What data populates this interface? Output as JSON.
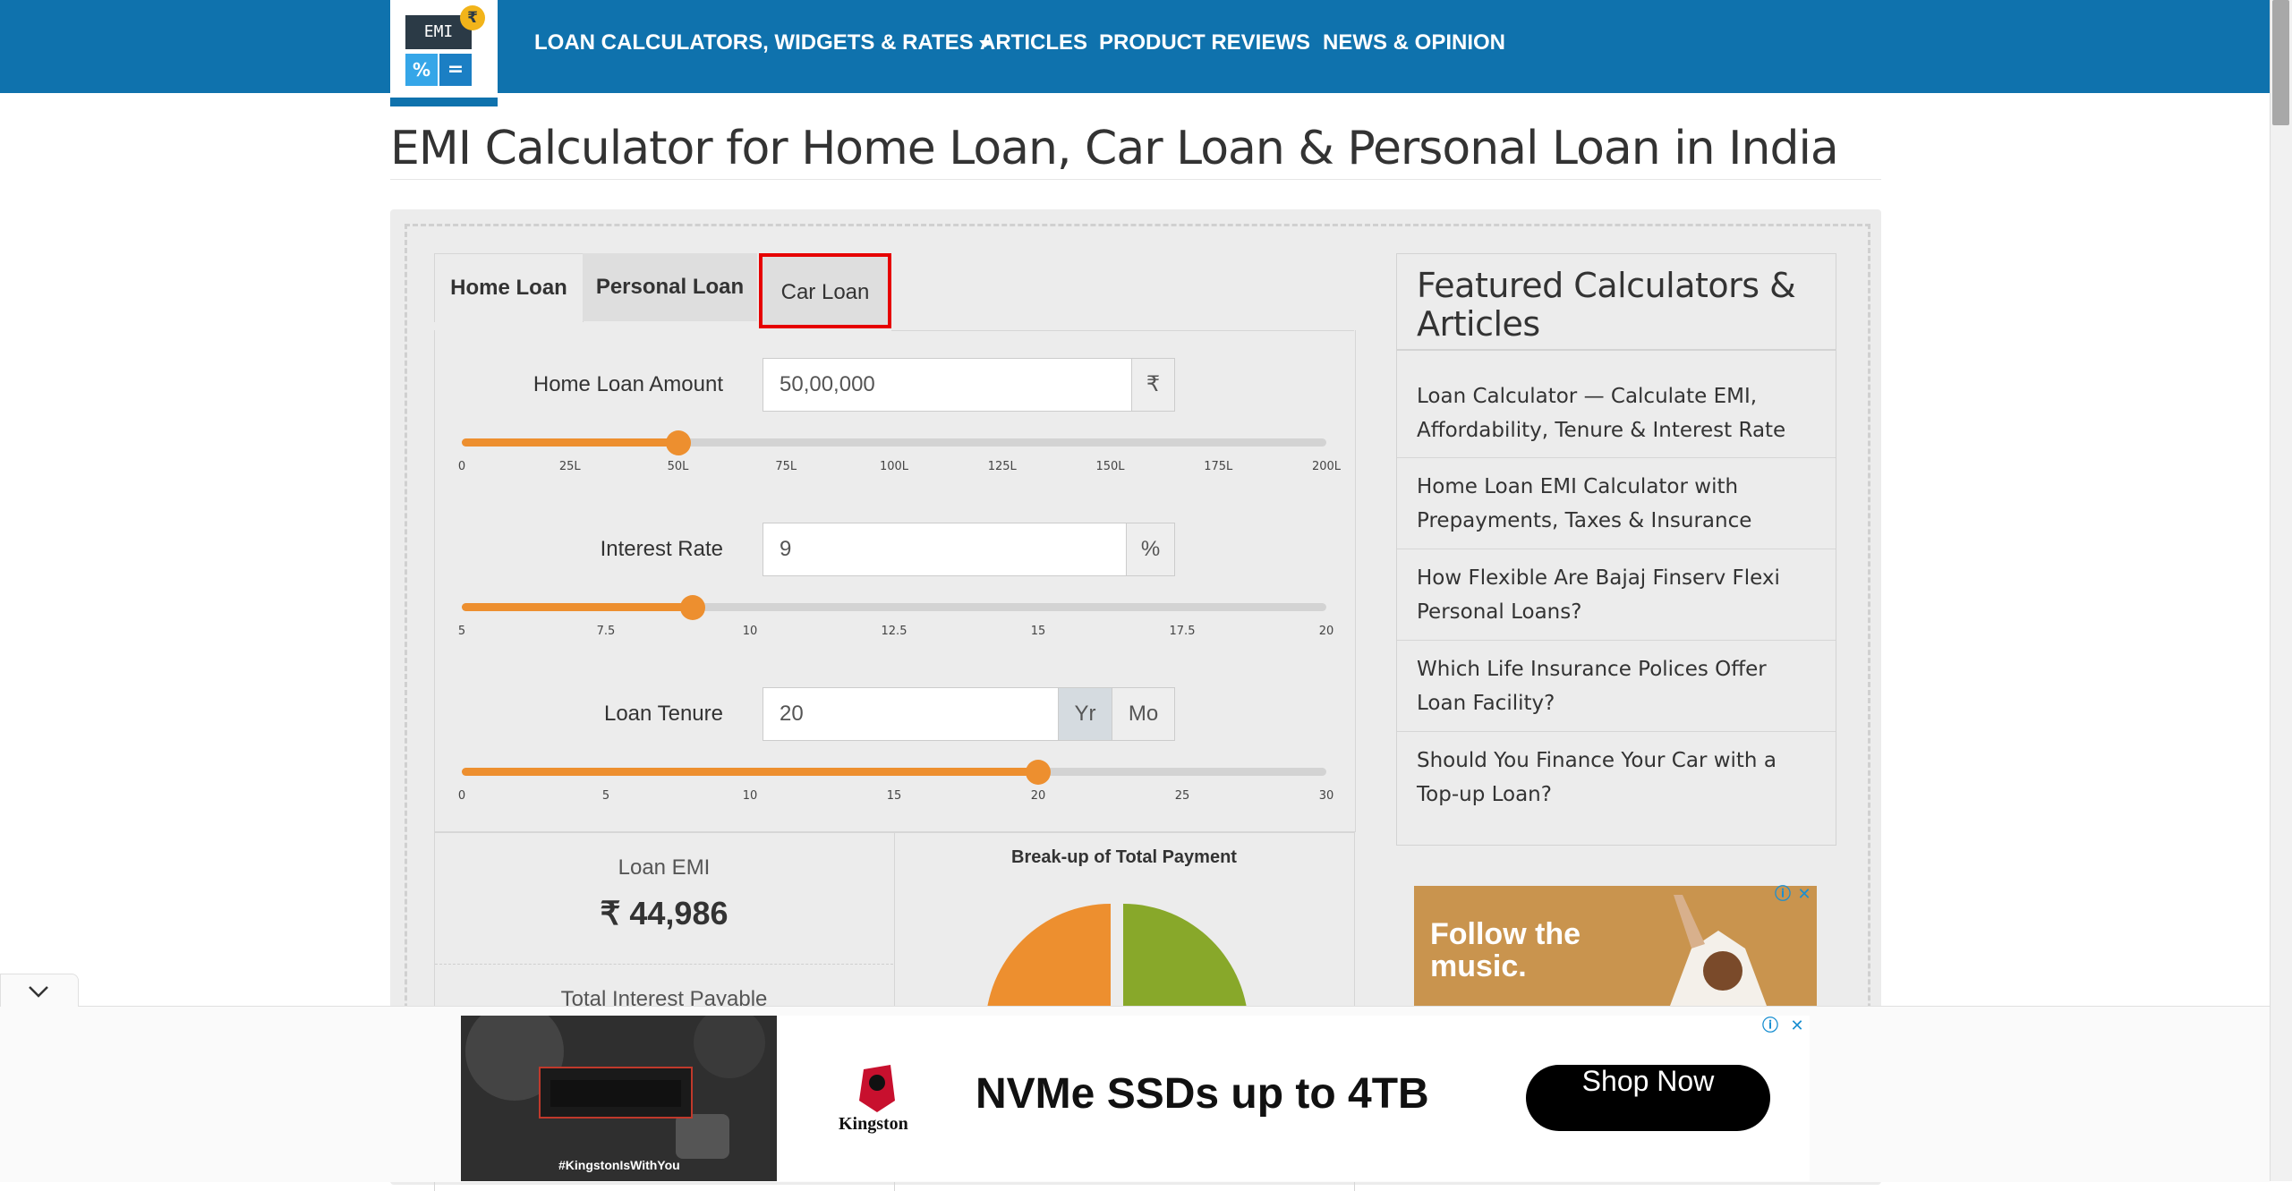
{
  "header": {
    "logo_screen": "EMI",
    "logo_coin": "₹",
    "logo_key1": "%",
    "logo_key2": "=",
    "nav": [
      {
        "label": "LOAN CALCULATORS, WIDGETS & RATES"
      },
      {
        "label": "ARTICLES"
      },
      {
        "label": "PRODUCT REVIEWS"
      },
      {
        "label": "NEWS & OPINION"
      }
    ]
  },
  "page_title": "EMI Calculator for Home Loan, Car Loan & Personal Loan in India",
  "tabs": [
    "Home Loan",
    "Personal Loan",
    "Car Loan"
  ],
  "form": {
    "amount": {
      "label": "Home Loan Amount",
      "value": "50,00,000",
      "addon": "₹",
      "ticks": [
        "0",
        "25L",
        "50L",
        "75L",
        "100L",
        "125L",
        "150L",
        "175L",
        "200L"
      ],
      "slider_value": 50,
      "slider_min": 0,
      "slider_max": 200
    },
    "rate": {
      "label": "Interest Rate",
      "value": "9",
      "addon": "%",
      "ticks": [
        "5",
        "7.5",
        "10",
        "12.5",
        "15",
        "17.5",
        "20"
      ],
      "slider_value": 9,
      "slider_min": 5,
      "slider_max": 20
    },
    "tenure": {
      "label": "Loan Tenure",
      "value": "20",
      "unit_year": "Yr",
      "unit_month": "Mo",
      "ticks": [
        "0",
        "5",
        "10",
        "15",
        "20",
        "25",
        "30"
      ],
      "slider_value": 20,
      "slider_min": 0,
      "slider_max": 30
    }
  },
  "results": {
    "emi_label": "Loan EMI",
    "emi_value": "₹ 44,986",
    "interest_label": "Total Interest Payable",
    "chart_title": "Break-up of Total Payment",
    "colors": {
      "principal": "#ed8f2f",
      "interest": "#88a82a"
    }
  },
  "sidebar": {
    "title": "Featured Calculators & Articles",
    "items": [
      {
        "label": "Loan Calculator — Calculate EMI, Affordability, Tenure & Interest Rate"
      },
      {
        "label": "Home Loan EMI Calculator with Prepayments, Taxes & Insurance"
      },
      {
        "label": "How Flexible Are Bajaj Finserv Flexi Personal Loans?"
      },
      {
        "label": "Which Life Insurance Polices Offer Loan Facility?"
      },
      {
        "label": "Should You Finance Your Car with a Top-up Loan?"
      }
    ],
    "ad_text": "Follow the music."
  },
  "bottom_ad": {
    "tag": "#KingstonIsWithYou",
    "brand": "Kingston",
    "headline": "NVMe SSDs up to 4TB",
    "button": "Shop Now",
    "info_icon": "ⓘ",
    "close_icon": "✕"
  },
  "colors": {
    "header": "#0f72ad",
    "accent": "#ed8f2f",
    "highlight_border": "#e60000"
  }
}
